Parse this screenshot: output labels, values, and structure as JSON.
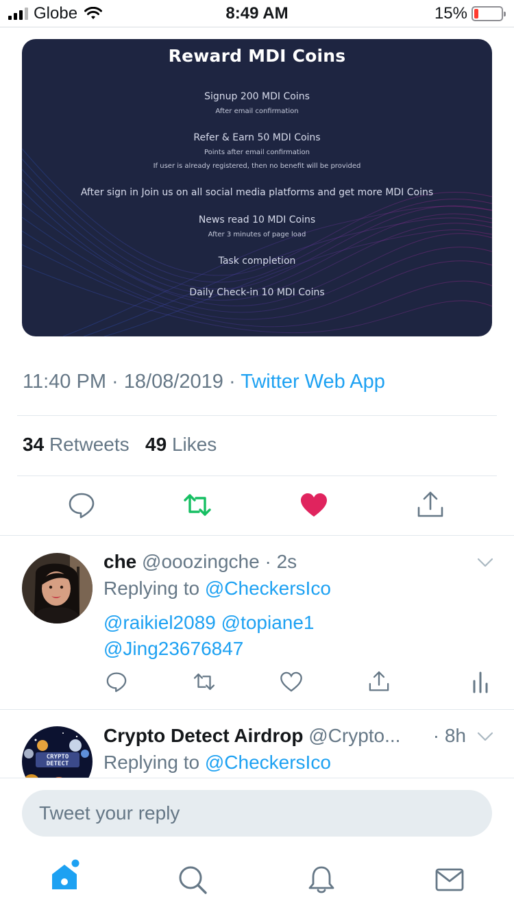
{
  "status_bar": {
    "carrier": "Globe",
    "time": "8:49 AM",
    "battery_percent": "15%",
    "battery_level": 0.15,
    "battery_color": "#ff3b30"
  },
  "media_card": {
    "title": "Reward MDI Coins",
    "items": [
      {
        "text": "Signup 200 MDI Coins",
        "subs": [
          "After email confirmation"
        ]
      },
      {
        "text": "Refer & Earn 50 MDI Coins",
        "subs": [
          "Points after email confirmation",
          "If user is already registered, then no benefit will be provided"
        ]
      },
      {
        "text": "After sign in Join us on all social media platforms and get more MDI Coins",
        "subs": []
      },
      {
        "text": "News read 10 MDI Coins",
        "subs": [
          "After 3 minutes of page load"
        ]
      },
      {
        "text": "Task completion",
        "subs": []
      },
      {
        "text": "Daily Check-in 10 MDI Coins",
        "subs": []
      }
    ]
  },
  "tweet_meta": {
    "time": "11:40 PM",
    "date": "18/08/2019",
    "separator": "·",
    "source": "Twitter Web App"
  },
  "stats": {
    "retweets_count": "34",
    "retweets_label": "Retweets",
    "likes_count": "49",
    "likes_label": "Likes"
  },
  "actions": {
    "reply_icon": "reply-icon",
    "retweet_icon": "retweet-icon",
    "like_icon": "heart-icon",
    "share_icon": "share-icon",
    "retweet_color": "#17bf63",
    "like_color": "#e0245e"
  },
  "replies": [
    {
      "name": "che",
      "handle": "@ooozingche",
      "time": "· 2s",
      "replying_prefix": "Replying to",
      "replying_to": "@CheckersIco",
      "body_line1": "@raikiel2089 @topiane1",
      "body_line2": "@Jing23676847"
    },
    {
      "name": "Crypto Detect Airdrop",
      "handle": "@Crypto...",
      "time": "· 8h",
      "replying_prefix": "Replying to",
      "replying_to": "@CheckersIco",
      "avatar_text_1": "CRYPTO",
      "avatar_text_2": "DETECT"
    }
  ],
  "composer": {
    "placeholder": "Tweet your reply"
  },
  "tabbar": {
    "items": [
      "home-icon",
      "search-icon",
      "bell-icon",
      "mail-icon"
    ],
    "accent": "#1da1f2"
  }
}
